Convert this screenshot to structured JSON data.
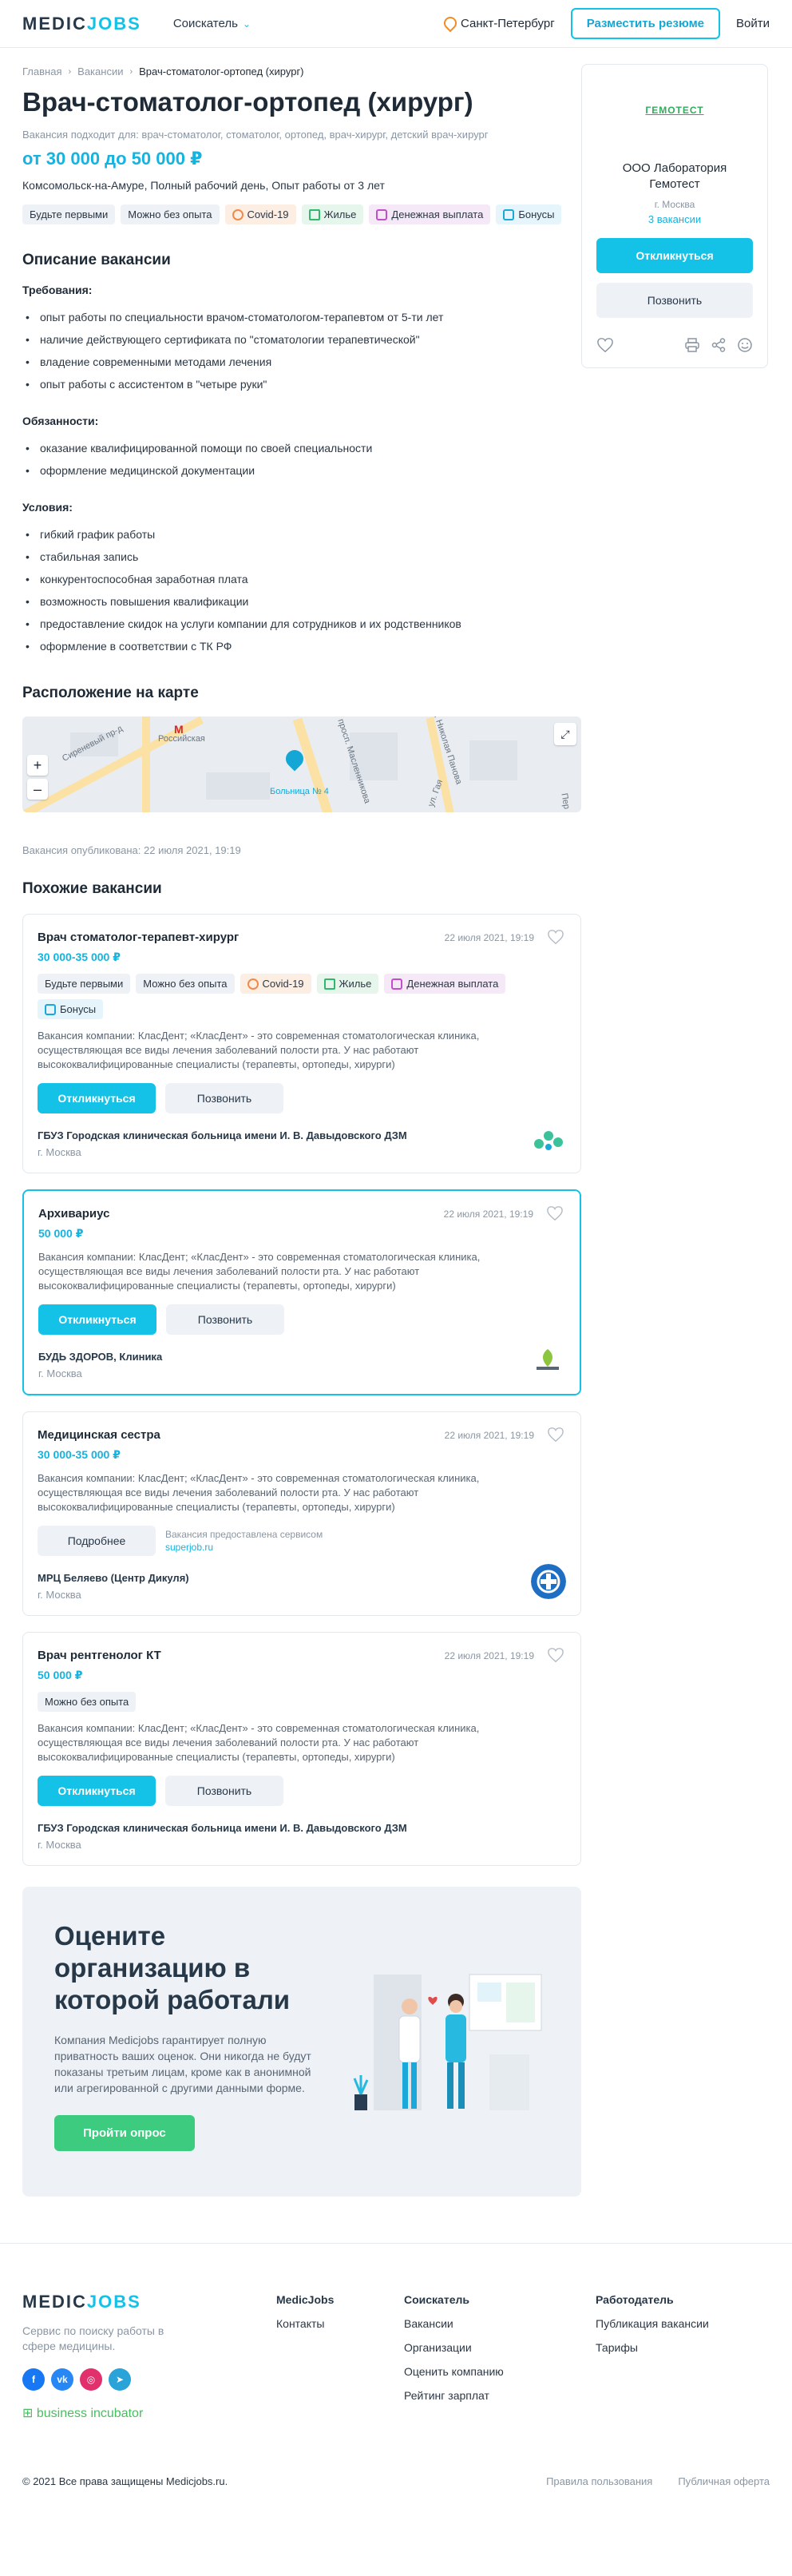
{
  "header": {
    "logo_a": "MEDIC",
    "logo_b": "JOBS",
    "role": "Соискатель",
    "city": "Санкт-Петербург",
    "post_resume": "Разместить резюме",
    "login": "Войти"
  },
  "breadcrumb": [
    "Главная",
    "Вакансии",
    "Врач-стоматолог-ортопед (хирург)"
  ],
  "vacancy": {
    "title": "Врач-стоматолог-ортопед (хирург)",
    "suits": "Вакансия подходит для: врач-стоматолог, стоматолог, ортопед, врач-хирург, детский врач-хирург",
    "salary": "от 30 000 до 50 000 ₽",
    "meta": "Комсомольск-на-Амуре, Полный рабочий день, Опыт работы от 3 лет",
    "tags": [
      "Будьте первыми",
      "Можно без опыта",
      "Covid-19",
      "Жилье",
      "Денежная выплата",
      "Бонусы"
    ]
  },
  "description": {
    "title": "Описание вакансии",
    "req_title": "Требования:",
    "requirements": [
      "опыт работы по специальности врачом-стоматологом-терапевтом от 5-ти лет",
      "наличие действующего сертификата по \"стоматологии терапевтической\"",
      "владение современными методами лечения",
      "опыт работы с ассистентом в \"четыре руки\""
    ],
    "duties_title": "Обязанности:",
    "duties": [
      "оказание квалифицированной помощи по своей специальности",
      "оформление медицинской документации"
    ],
    "cond_title": "Условия:",
    "conditions": [
      "гибкий график работы",
      "стабильная запись",
      "конкурентоспособная заработная плата",
      "возможность повышения квалификации",
      "предоставление скидок на услуги компании для сотрудников и их родственников",
      "оформление в соответствии с ТК РФ"
    ]
  },
  "map": {
    "title": "Расположение на карте",
    "street_1": "Сиреневый пр-д",
    "metro": "Российская",
    "street_2": "просп. Масленникова",
    "street_3": "ул. Николая Панова",
    "street_4": "ул. Гая",
    "street_5": "Пер",
    "marker_label": "Больница № 4",
    "zoom_in": "+",
    "zoom_out": "–"
  },
  "published": "Вакансия опубликована: 22 июля 2021, 19:19",
  "similar_title": "Похожие вакансии",
  "similar": [
    {
      "title": "Врач стоматолог-терапевт-хирург",
      "date": "22 июля 2021, 19:19",
      "salary": "30 000-35 000 ₽",
      "tags": [
        "Будьте первыми",
        "Можно без опыта",
        "Covid-19",
        "Жилье",
        "Денежная выплата",
        "Бонусы"
      ],
      "desc": "Вакансия компании: КласДент; «КласДент» - это современная стоматологическая клиника, осуществляющая все виды лечения заболеваний полости рта. У нас работают высококвалифицированные специалисты (терапевты, ортопеды, хирурги)",
      "apply": "Откликнуться",
      "call": "Позвонить",
      "company": "ГБУЗ Городская клиническая больница имени И. В. Давыдовского ДЗМ",
      "city": "г. Москва"
    },
    {
      "title": "Архивариус",
      "date": "22 июля 2021, 19:19",
      "salary": "50 000 ₽",
      "desc": "Вакансия компании: КласДент; «КласДент» - это современная стоматологическая клиника, осуществляющая все виды лечения заболеваний полости рта. У нас работают высококвалифицированные специалисты (терапевты, ортопеды, хирурги)",
      "apply": "Откликнуться",
      "call": "Позвонить",
      "company": "БУДЬ ЗДОРОВ, Клиника",
      "city": "г. Москва"
    },
    {
      "title": "Медицинская сестра",
      "date": "22 июля 2021, 19:19",
      "salary": "30 000-35 000 ₽",
      "desc": "Вакансия компании: КласДент; «КласДент» - это современная стоматологическая клиника, осуществляющая все виды лечения заболеваний полости рта. У нас работают высококвалифицированные специалисты (терапевты, ортопеды, хирурги)",
      "more": "Подробнее",
      "svc_text": "Вакансия предоставлена сервисом",
      "svc_link": "superjob.ru",
      "company": "МРЦ Беляево (Центр Дикуля)",
      "city": "г. Москва"
    },
    {
      "title": "Врач рентгенолог КТ",
      "date": "22 июля 2021, 19:19",
      "salary": "50 000 ₽",
      "tags": [
        "Можно без опыта"
      ],
      "desc": "Вакансия компании: КласДент; «КласДент» - это современная стоматологическая клиника, осуществляющая все виды лечения заболеваний полости рта. У нас работают высококвалифицированные специалисты (терапевты, ортопеды, хирурги)",
      "apply": "Откликнуться",
      "call": "Позвонить",
      "company": "ГБУЗ Городская клиническая больница имени И. В. Давыдовского ДЗМ",
      "city": "г. Москва"
    }
  ],
  "survey": {
    "title": "Оцените организацию в которой работали",
    "text": "Компания Medicjobs гарантирует полную приватность ваших оценок. Они никогда не будут показаны третьим лицам, кроме как в анонимной или агрегированной с другими данными форме.",
    "button": "Пройти опрос"
  },
  "aside": {
    "logo": "ГЕМОТЕСТ",
    "name": "ООО Лаборатория Гемотест",
    "city": "г. Москва",
    "count": "3 вакансии",
    "apply": "Откликнуться",
    "call": "Позвонить"
  },
  "footer": {
    "tagline": "Сервис по поиску работы в сфере медицины.",
    "incubator": "business incubator",
    "col1_title": "MedicJobs",
    "col1": [
      "Контакты"
    ],
    "col2_title": "Соискатель",
    "col2": [
      "Вакансии",
      "Организации",
      "Оценить компанию",
      "Рейтинг зарплат"
    ],
    "col3_title": "Работодатель",
    "col3": [
      "Публикация вакансии",
      "Тарифы"
    ],
    "copyright": "© 2021 Все права защищены Medicjobs.ru.",
    "terms": "Правила пользования",
    "offer": "Публичная оферта"
  },
  "colors": {
    "accent": "#14c2e8",
    "green": "#3ccb7f",
    "text": "#1f2a37"
  }
}
